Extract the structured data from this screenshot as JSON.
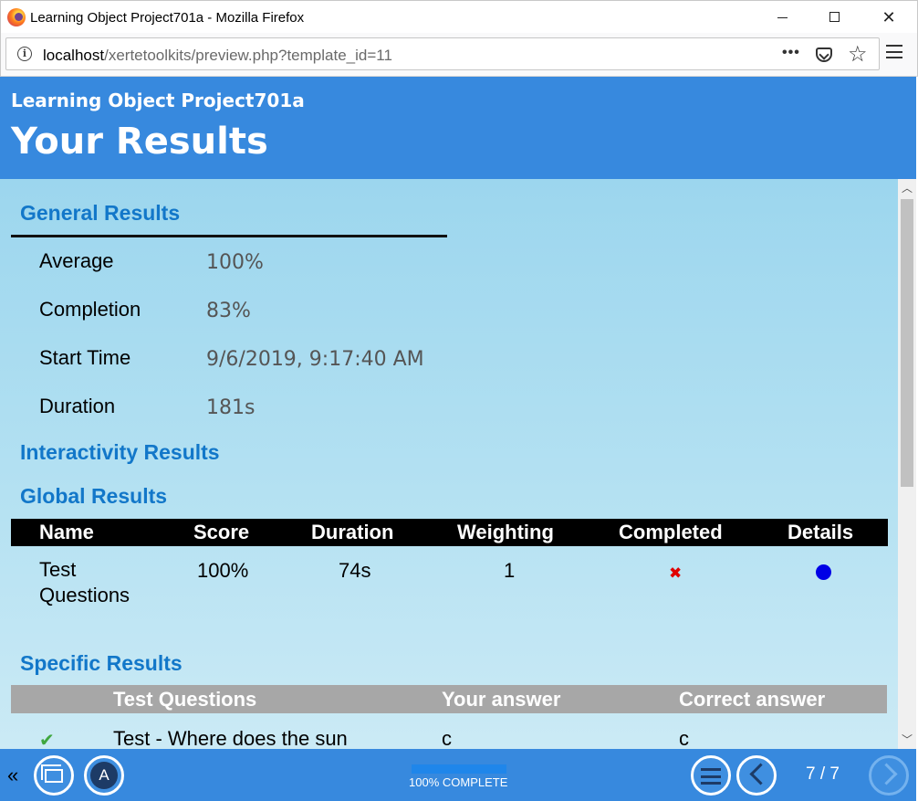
{
  "window": {
    "title": "Learning Object Project701a - Mozilla Firefox",
    "url_host": "localhost",
    "url_path": "/xertetoolkits/preview.php?template_id=11"
  },
  "header": {
    "project_title": "Learning Object Project701a",
    "page_title": "Your Results"
  },
  "general": {
    "heading": "General Results",
    "rows": [
      {
        "label": "Average",
        "value": "100%"
      },
      {
        "label": "Completion",
        "value": "83%"
      },
      {
        "label": "Start Time",
        "value": "9/6/2019, 9:17:40 AM"
      },
      {
        "label": "Duration",
        "value": "181s"
      }
    ]
  },
  "interactivity_heading": "Interactivity Results",
  "global": {
    "heading": "Global Results",
    "columns": [
      "Name",
      "Score",
      "Duration",
      "Weighting",
      "Completed",
      "Details"
    ],
    "row": {
      "name": "Test Questions",
      "score": "100%",
      "duration": "74s",
      "weighting": "1",
      "completed_icon": "cross-icon",
      "details_icon": "dot-icon"
    }
  },
  "specific": {
    "heading": "Specific Results",
    "columns": [
      "Test Questions",
      "Your answer",
      "Correct answer"
    ],
    "row": {
      "status_icon": "check-icon",
      "question": "Test - Where does the sun",
      "your_answer": "c",
      "correct_answer": "c"
    }
  },
  "footer": {
    "progress_text": "100% COMPLETE",
    "progress_fraction": 1.0,
    "page_counter": "7 / 7",
    "accessibility_label": "A"
  },
  "colors": {
    "header_bg": "#3789de",
    "heading_blue": "#1277c9",
    "content_bg": "#9cd6ee"
  }
}
